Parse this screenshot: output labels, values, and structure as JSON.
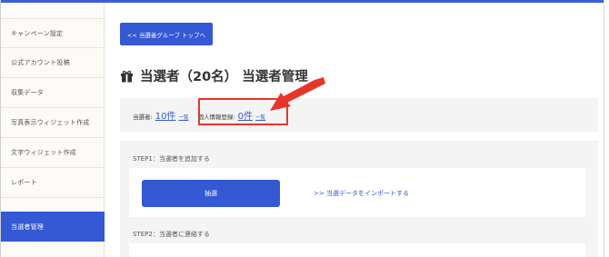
{
  "colors": {
    "accent": "#3558d4",
    "highlight": "#e8352a",
    "sidebar_bg": "#fdfbf7",
    "panel_bg": "#f4f4f4"
  },
  "sidebar": {
    "items": [
      {
        "label": "キャンペーン設定"
      },
      {
        "label": "公式アカウント投稿"
      },
      {
        "label": "収集データ"
      },
      {
        "label": "写真表示ウィジェット作成"
      },
      {
        "label": "文字ウィジェット作成"
      },
      {
        "label": "レポート"
      }
    ],
    "active_item": {
      "label": "当選者管理"
    }
  },
  "main": {
    "back_button_label": "<< 当選者グループ トップへ",
    "title_icon": "gift-icon",
    "page_title": "当選者（20名） 当選者管理",
    "counts": {
      "winners_label": "当選者:",
      "winners_value": "10件",
      "winners_link": "一覧",
      "personal_label": "個人情報登録:",
      "personal_value": "0件",
      "personal_link": "一覧"
    },
    "step1": {
      "label": "STEP1：当選者を追加する",
      "draw_button_label": "抽選",
      "import_link_label": ">> 当選データをインポートする"
    },
    "step2": {
      "label": "STEP2：当選者に連絡する"
    }
  }
}
